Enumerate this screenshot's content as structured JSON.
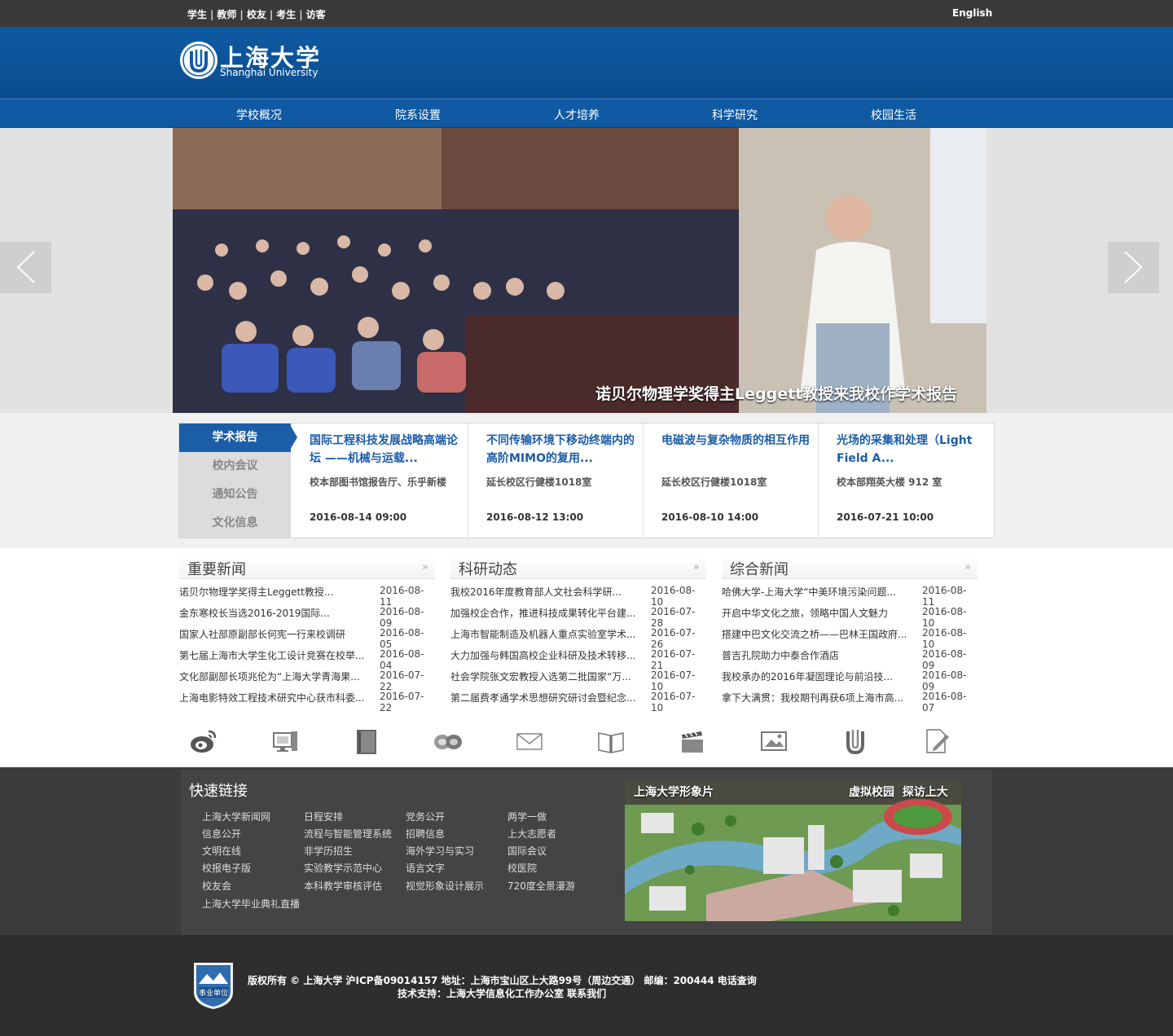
{
  "topbar": {
    "links": [
      "学生",
      "教师",
      "校友",
      "考生",
      "访客"
    ],
    "english": "English"
  },
  "header": {
    "logo_cn": "上海大学",
    "logo_en": "Shanghai University"
  },
  "nav": [
    "学校概况",
    "院系设置",
    "人才培养",
    "科学研究",
    "校园生活"
  ],
  "banner": {
    "caption": "诺贝尔物理学奖得主Leggett教授来我校作学术报告"
  },
  "talks": {
    "tabs": [
      "学术报告",
      "校内会议",
      "通知公告",
      "文化信息"
    ],
    "active_tab": "学术报告",
    "items": [
      {
        "title": "国际工程科技发展战略高端论坛 ——机械与运载...",
        "location": "校本部图书馆报告厅、乐乎新楼",
        "datetime": "2016-08-14 09:00"
      },
      {
        "title": "不同传输环境下移动终端内的高阶MIMO的复用...",
        "location": "延长校区行健楼1018室",
        "datetime": "2016-08-12 13:00"
      },
      {
        "title": "电磁波与复杂物质的相互作用",
        "location": "延长校区行健楼1018室",
        "datetime": "2016-08-10 14:00"
      },
      {
        "title": "光场的采集和处理（Light Field A...",
        "location": "校本部翔英大楼 912 室",
        "datetime": "2016-07-21 10:00"
      }
    ]
  },
  "news": [
    {
      "heading": "重要新闻",
      "more": "»",
      "items": [
        {
          "text": "诺贝尔物理学奖得主Leggett教授...",
          "date": "2016-08-11"
        },
        {
          "text": "金东寒校长当选2016-2019国际...",
          "date": "2016-08-09"
        },
        {
          "text": "国家人社部原副部长何宪一行来校调研",
          "date": "2016-08-05"
        },
        {
          "text": "第七届上海市大学生化工设计竞赛在校举...",
          "date": "2016-08-04"
        },
        {
          "text": "文化部副部长项兆伦为“上海大学青海果...",
          "date": "2016-07-22"
        },
        {
          "text": "上海电影特效工程技术研究中心获市科委...",
          "date": "2016-07-22"
        }
      ]
    },
    {
      "heading": "科研动态",
      "more": "»",
      "items": [
        {
          "text": "我校2016年度教育部人文社会科学研...",
          "date": "2016-08-10"
        },
        {
          "text": "加强校企合作，推进科技成果转化平台建...",
          "date": "2016-07-28"
        },
        {
          "text": "上海市智能制造及机器人重点实验室学术...",
          "date": "2016-07-26"
        },
        {
          "text": "大力加强与韩国高校企业科研及技术转移...",
          "date": "2016-07-21"
        },
        {
          "text": "社会学院张文宏教授入选第二批国家“万...",
          "date": "2016-07-10"
        },
        {
          "text": "第二届费孝通学术思想研究研讨会暨纪念...",
          "date": "2016-07-10"
        }
      ]
    },
    {
      "heading": "综合新闻",
      "more": "»",
      "items": [
        {
          "text": "哈佛大学-上海大学“中美环境污染问题...",
          "date": "2016-08-11"
        },
        {
          "text": "开启中华文化之旅，领略中国人文魅力",
          "date": "2016-08-10"
        },
        {
          "text": "搭建中巴文化交流之桥——巴林王国政府...",
          "date": "2016-08-10"
        },
        {
          "text": "普吉孔院助力中泰合作酒店",
          "date": "2016-08-09"
        },
        {
          "text": "我校承办的2016年凝固理论与前沿技...",
          "date": "2016-08-09"
        },
        {
          "text": "拿下大满贯：我校期刊再获6项上海市高...",
          "date": "2016-08-07"
        }
      ]
    }
  ],
  "service_icons": [
    "weibo-icon",
    "computer-icon",
    "notebook-icon",
    "chat-icon",
    "mail-icon",
    "book-icon",
    "video-icon",
    "photo-icon",
    "university-icon",
    "edit-icon"
  ],
  "quick_links": {
    "title": "快速链接",
    "columns": [
      [
        "上海大学新闻网",
        "信息公开",
        "文明在线",
        "校报电子版",
        "校友会",
        "上海大学毕业典礼直播"
      ],
      [
        "日程安排",
        "流程与智能管理系统",
        "非学历招生",
        "实验教学示范中心",
        "本科教学审核评估"
      ],
      [
        "党务公开",
        "招聘信息",
        "海外学习与实习",
        "语言文字",
        "视觉形象设计展示"
      ],
      [
        "两学一做",
        "上大志愿者",
        "国际会议",
        "校医院",
        "720度全景漫游"
      ]
    ]
  },
  "promo": {
    "title": "上海大学形象片",
    "link1": "虚拟校园",
    "link2": "探访上大"
  },
  "footer": {
    "badge_text": "事业单位",
    "line1": "版权所有 © 上海大学   沪ICP备09014157   地址：上海市宝山区上大路99号（周边交通）   邮编：200444   电话查询",
    "line2": "技术支持：上海大学信息化工作办公室   联系我们"
  },
  "colors": {
    "brand_blue": "#0f5aa3",
    "accent_blue": "#1c5da8",
    "dark_bar": "#3a3a3a"
  }
}
